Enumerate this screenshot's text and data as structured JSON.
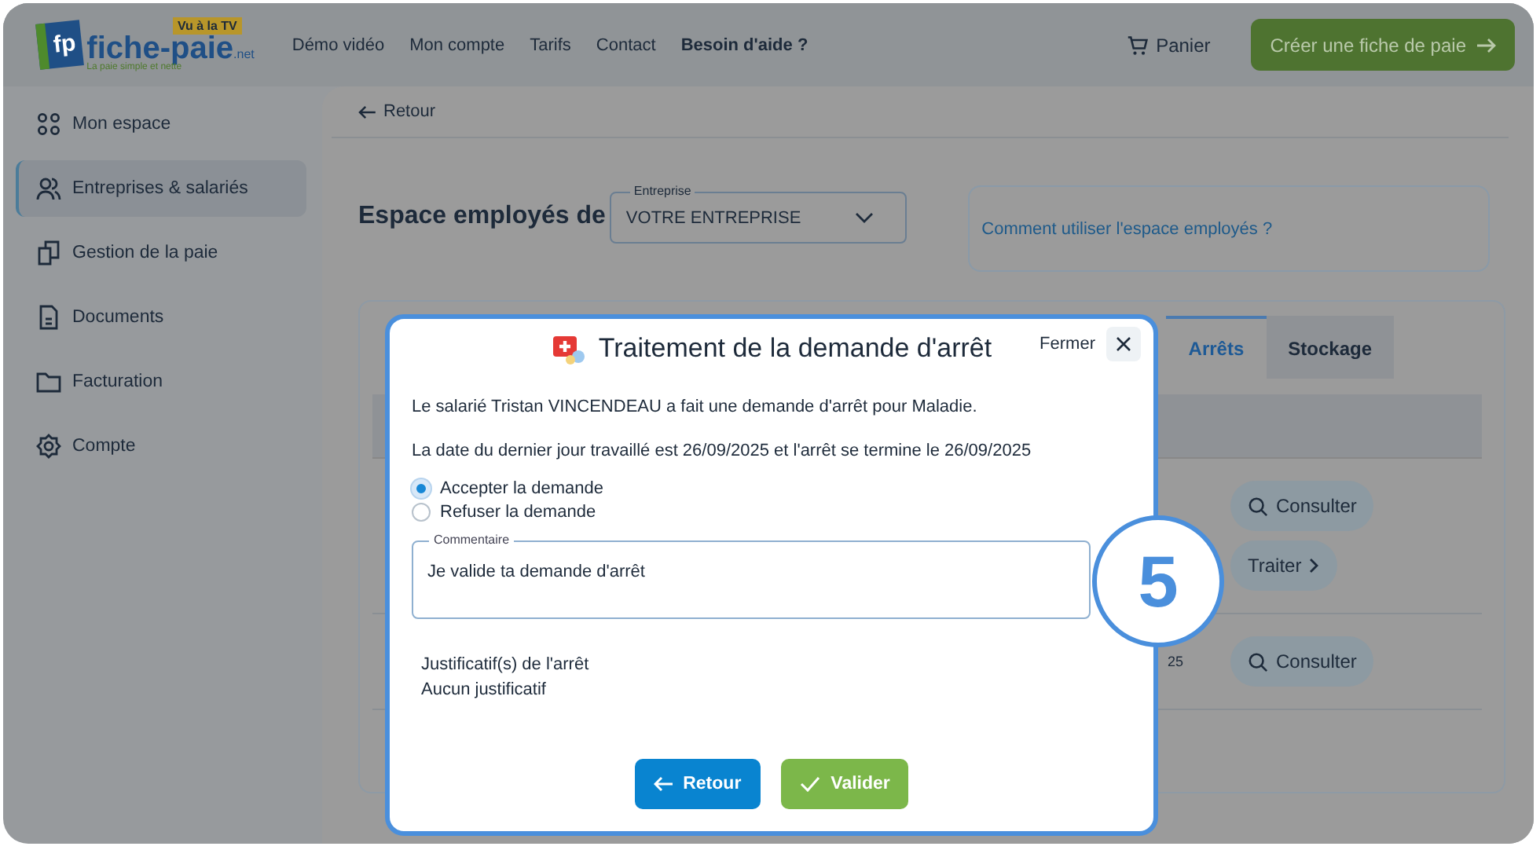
{
  "header": {
    "logo": {
      "badge": "Vu à la TV",
      "mark": "fp",
      "name": "fiche-paie",
      "suffix": ".net",
      "tagline": "La paie simple et nette"
    },
    "nav": [
      {
        "label": "Démo vidéo",
        "bold": false
      },
      {
        "label": "Mon compte",
        "bold": false
      },
      {
        "label": "Tarifs",
        "bold": false
      },
      {
        "label": "Contact",
        "bold": false
      },
      {
        "label": "Besoin d'aide ?",
        "bold": true
      }
    ],
    "cart": "Panier",
    "cta": "Créer une fiche de paie"
  },
  "sidebar": {
    "items": [
      {
        "label": "Mon espace",
        "kind": "grid",
        "selected": false
      },
      {
        "label": "Entreprises & salariés",
        "kind": "people",
        "selected": true
      },
      {
        "label": "Gestion de la paie",
        "kind": "pages",
        "selected": false
      },
      {
        "label": "Documents",
        "kind": "doc",
        "selected": false
      },
      {
        "label": "Facturation",
        "kind": "folder",
        "selected": false
      },
      {
        "label": "Compte",
        "kind": "gear",
        "selected": false
      }
    ]
  },
  "main": {
    "back": "Retour",
    "title": "Espace employés de",
    "company": {
      "label": "Entreprise",
      "value": "VOTRE ENTREPRISE"
    },
    "help_link": "Comment utiliser l'espace employés ?",
    "tabs": [
      {
        "label": "Arrêts",
        "selected": true
      },
      {
        "label": "Stockage",
        "selected": false
      }
    ],
    "rows": [
      {
        "column_1": "",
        "actions": [
          {
            "label": "Consulter",
            "kind": "view"
          },
          {
            "label": "Traiter",
            "kind": "process"
          }
        ]
      },
      {
        "column_1": "25",
        "actions": [
          {
            "label": "Consulter",
            "kind": "view"
          }
        ]
      }
    ]
  },
  "modal": {
    "title": "Traitement de la demande d'arrêt",
    "close": "Fermer",
    "paragraphs": [
      "Le salarié Tristan VINCENDEAU a fait une demande d'arrêt pour Maladie.",
      "La date du dernier jour travaillé est 26/09/2025 et l'arrêt se termine le 26/09/2025"
    ],
    "options": [
      {
        "label": "Accepter la demande",
        "selected": true
      },
      {
        "label": "Refuser la demande",
        "selected": false
      }
    ],
    "comment": {
      "label": "Commentaire",
      "value": "Je valide ta demande d'arrêt"
    },
    "attachments": {
      "heading": "Justificatif(s) de l'arrêt",
      "value": "Aucun justificatif"
    },
    "buttons": [
      {
        "label": "Retour",
        "kind": "back"
      },
      {
        "label": "Valider",
        "kind": "confirm"
      }
    ]
  },
  "step_badge": "5"
}
